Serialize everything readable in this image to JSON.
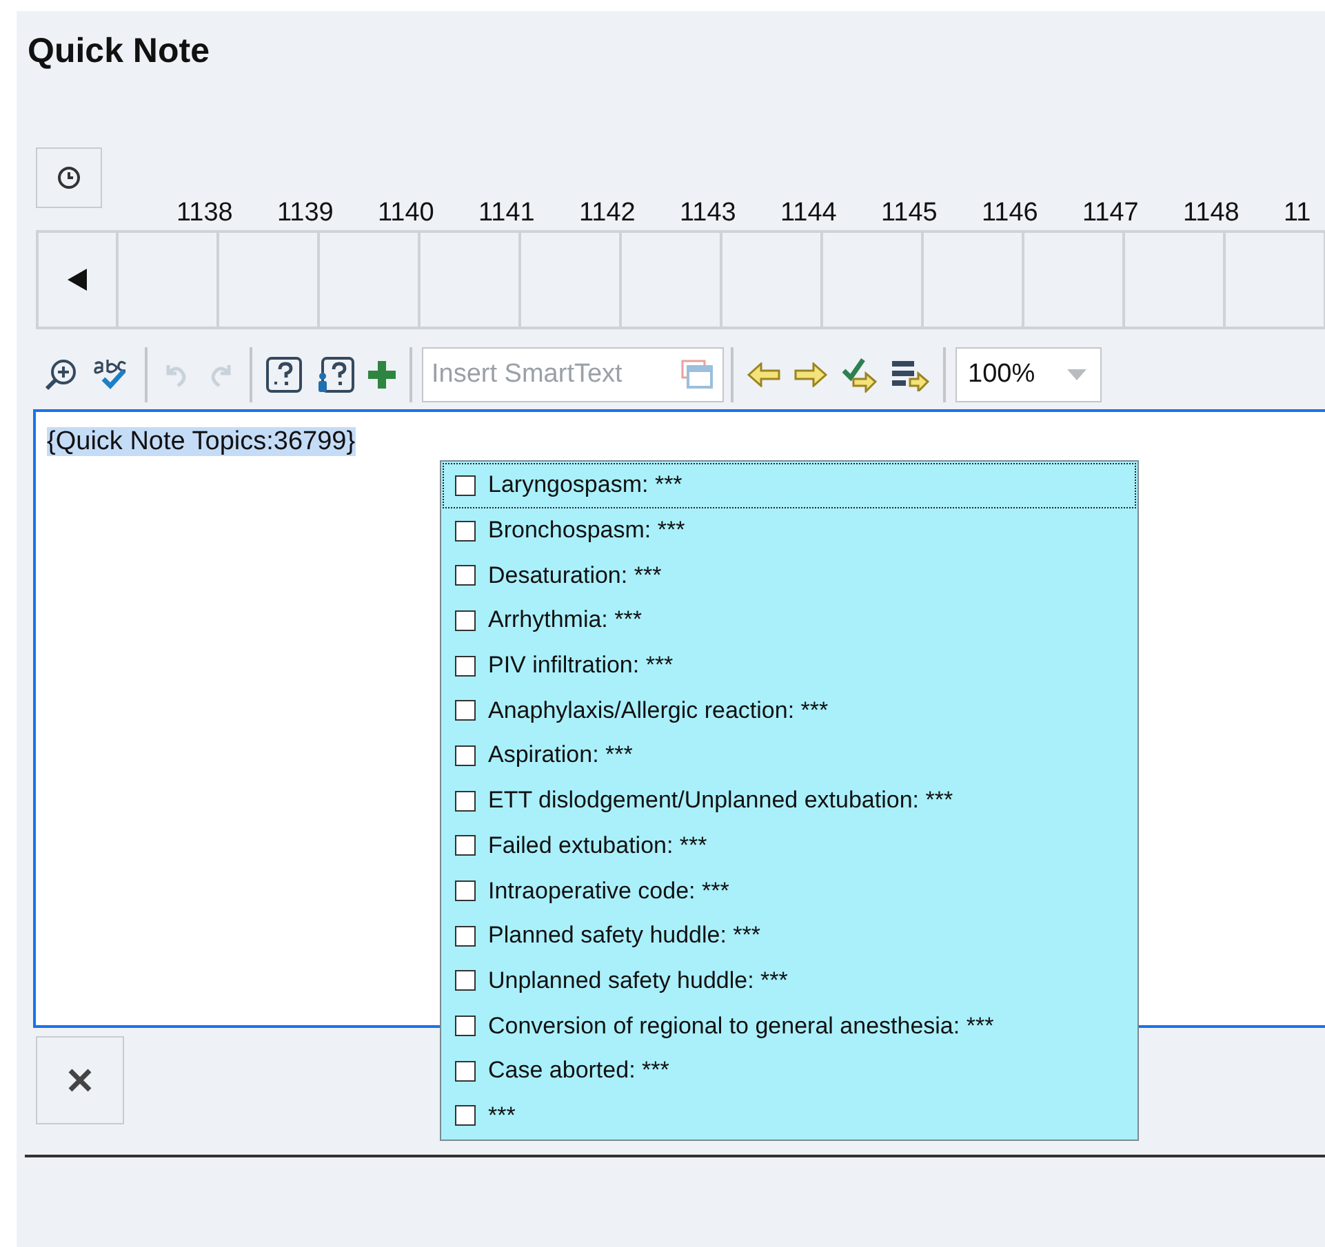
{
  "title": "Quick Note",
  "timeline": {
    "columns": [
      "1138",
      "1139",
      "1140",
      "1141",
      "1142",
      "1143",
      "1144",
      "1145",
      "1146",
      "1147",
      "1148",
      "11"
    ]
  },
  "toolbar": {
    "undo": {
      "disabled": true
    },
    "redo": {
      "disabled": true
    },
    "smarttext": {
      "placeholder": "Insert SmartText"
    },
    "zoom": {
      "value": "100%"
    }
  },
  "editor": {
    "text": "{Quick Note Topics:36799}",
    "selected": true
  },
  "topics": [
    {
      "label": "Laryngospasm: ***",
      "checked": false,
      "focused": true
    },
    {
      "label": "Bronchospasm: ***",
      "checked": false,
      "focused": false
    },
    {
      "label": "Desaturation: ***",
      "checked": false,
      "focused": false
    },
    {
      "label": "Arrhythmia: ***",
      "checked": false,
      "focused": false
    },
    {
      "label": "PIV infiltration: ***",
      "checked": false,
      "focused": false
    },
    {
      "label": "Anaphylaxis/Allergic reaction: ***",
      "checked": false,
      "focused": false
    },
    {
      "label": "Aspiration: ***",
      "checked": false,
      "focused": false
    },
    {
      "label": "ETT dislodgement/Unplanned extubation: ***",
      "checked": false,
      "focused": false
    },
    {
      "label": "Failed extubation: ***",
      "checked": false,
      "focused": false
    },
    {
      "label": "Intraoperative code: ***",
      "checked": false,
      "focused": false
    },
    {
      "label": "Planned safety huddle: ***",
      "checked": false,
      "focused": false
    },
    {
      "label": "Unplanned safety huddle: ***",
      "checked": false,
      "focused": false
    },
    {
      "label": "Conversion of regional to general anesthesia: ***",
      "checked": false,
      "focused": false
    },
    {
      "label": "Case aborted: ***",
      "checked": false,
      "focused": false
    },
    {
      "label": "***",
      "checked": false,
      "focused": false
    }
  ]
}
